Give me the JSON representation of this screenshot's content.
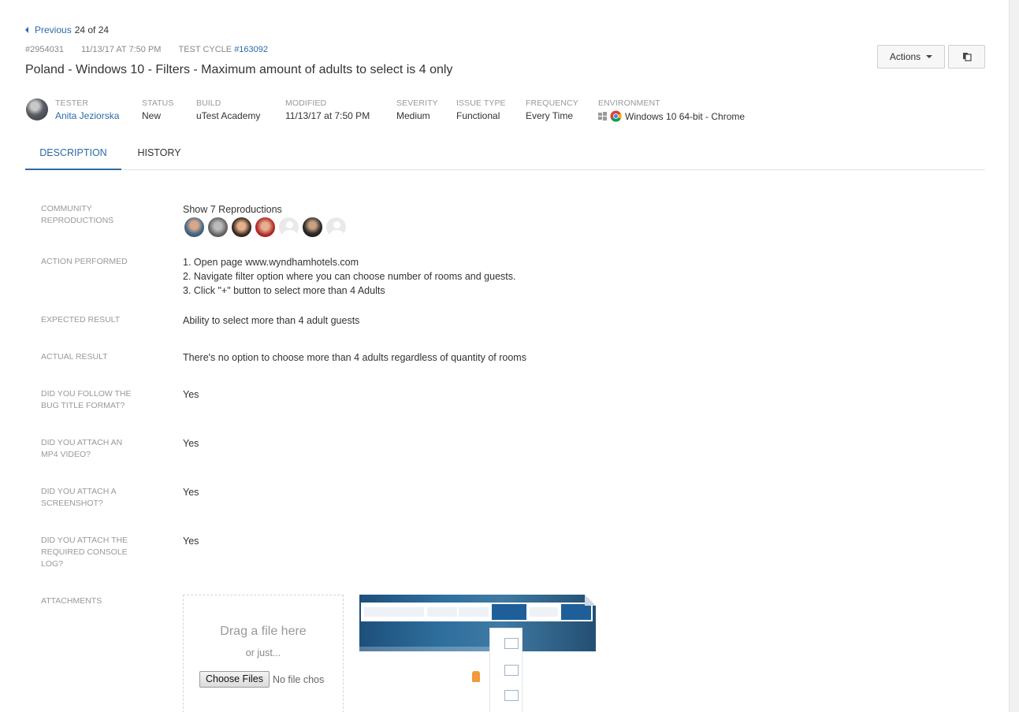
{
  "nav": {
    "previous_label": "Previous",
    "position": "24 of 24"
  },
  "meta": {
    "issue_id": "#2954031",
    "created": "11/13/17 AT 7:50 PM",
    "test_cycle_label": "TEST CYCLE",
    "test_cycle_link": "#163092"
  },
  "title": "Poland - Windows 10 - Filters - Maximum amount of adults to select is 4 only",
  "toolbar": {
    "actions_label": "Actions"
  },
  "fields": {
    "tester": {
      "label": "TESTER",
      "value": "Anita Jeziorska"
    },
    "status": {
      "label": "STATUS",
      "value": "New"
    },
    "build": {
      "label": "BUILD",
      "value": "uTest Academy"
    },
    "modified": {
      "label": "MODIFIED",
      "value": "11/13/17 at 7:50 PM"
    },
    "severity": {
      "label": "SEVERITY",
      "value": "Medium"
    },
    "issue_type": {
      "label": "ISSUE TYPE",
      "value": "Functional"
    },
    "frequency": {
      "label": "FREQUENCY",
      "value": "Every Time"
    },
    "environment": {
      "label": "ENVIRONMENT",
      "value": "Windows 10 64-bit - Chrome"
    }
  },
  "tabs": [
    {
      "label": "DESCRIPTION",
      "active": true
    },
    {
      "label": "HISTORY",
      "active": false
    }
  ],
  "details": {
    "community_reproductions": {
      "label": "COMMUNITY REPRODUCTIONS",
      "link": "Show 7 Reproductions"
    },
    "action_performed": {
      "label": "ACTION PERFORMED",
      "steps": [
        "1. Open page www.wyndhamhotels.com",
        "2. Navigate filter option where you can choose number of rooms and guests.",
        "3. Click \"+\" button to select more than 4 Adults"
      ]
    },
    "expected_result": {
      "label": "EXPECTED RESULT",
      "value": "Ability to select more than 4 adult guests"
    },
    "actual_result": {
      "label": "ACTUAL RESULT",
      "value": "There's no option to choose more than 4 adults regardless of quantity of rooms"
    },
    "bug_title_format": {
      "label": "DID YOU FOLLOW THE BUG TITLE FORMAT?",
      "value": "Yes"
    },
    "mp4_video": {
      "label": "DID YOU ATTACH AN MP4 VIDEO?",
      "value": "Yes"
    },
    "screenshot": {
      "label": "DID YOU ATTACH A SCREENSHOT?",
      "value": "Yes"
    },
    "console_log": {
      "label": "DID YOU ATTACH THE REQUIRED CONSOLE LOG?",
      "value": "Yes"
    },
    "attachments": {
      "label": "ATTACHMENTS",
      "drop_title": "Drag a file here",
      "drop_sub": "or just...",
      "choose_files": "Choose Files",
      "no_file": "No file chosen"
    }
  },
  "icons": {
    "previous": "caret-left-icon",
    "actions_dropdown": "caret-down-icon",
    "copy": "copy-icon",
    "windows": "windows-icon",
    "chrome": "chrome-icon"
  },
  "colors": {
    "link": "#2c6aa7",
    "label": "#999999",
    "text": "#333333"
  }
}
